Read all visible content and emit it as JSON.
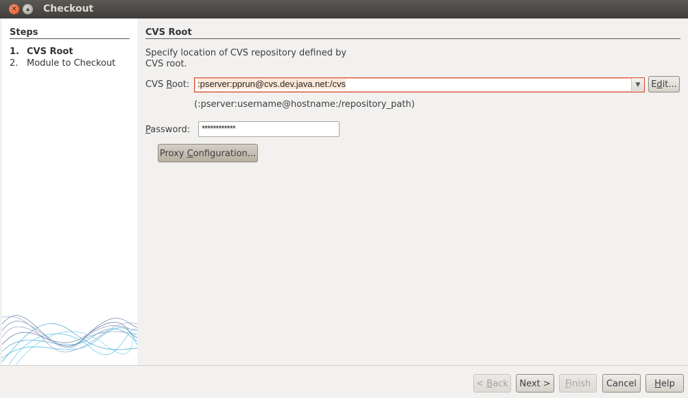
{
  "window": {
    "title": "Checkout"
  },
  "steps": {
    "title": "Steps",
    "items": [
      {
        "num": "1.",
        "label": "CVS Root"
      },
      {
        "num": "2.",
        "label": "Module to Checkout"
      }
    ]
  },
  "panel": {
    "title": "CVS Root",
    "description": "Specify location of CVS repository defined by CVS root.",
    "cvs_root_label_pre": "CVS ",
    "cvs_root_label_mnemonic": "R",
    "cvs_root_label_post": "oot:",
    "cvs_root_value": ":pserver:pprun@cvs.dev.java.net:/cvs",
    "edit_button_pre": "E",
    "edit_button_mnemonic": "d",
    "edit_button_post": "it...",
    "format_hint": "(:pserver:username@hostname:/repository_path)",
    "password_label_mnemonic": "P",
    "password_label_post": "assword:",
    "password_value": "************",
    "proxy_button_pre": "Proxy ",
    "proxy_button_mnemonic": "C",
    "proxy_button_post": "onfiguration..."
  },
  "footer": {
    "back_pre": "< ",
    "back_mnemonic": "B",
    "back_post": "ack",
    "next": "Next >",
    "finish_mnemonic": "F",
    "finish_post": "inish",
    "cancel": "Cancel",
    "help_mnemonic": "H",
    "help_post": "elp"
  }
}
